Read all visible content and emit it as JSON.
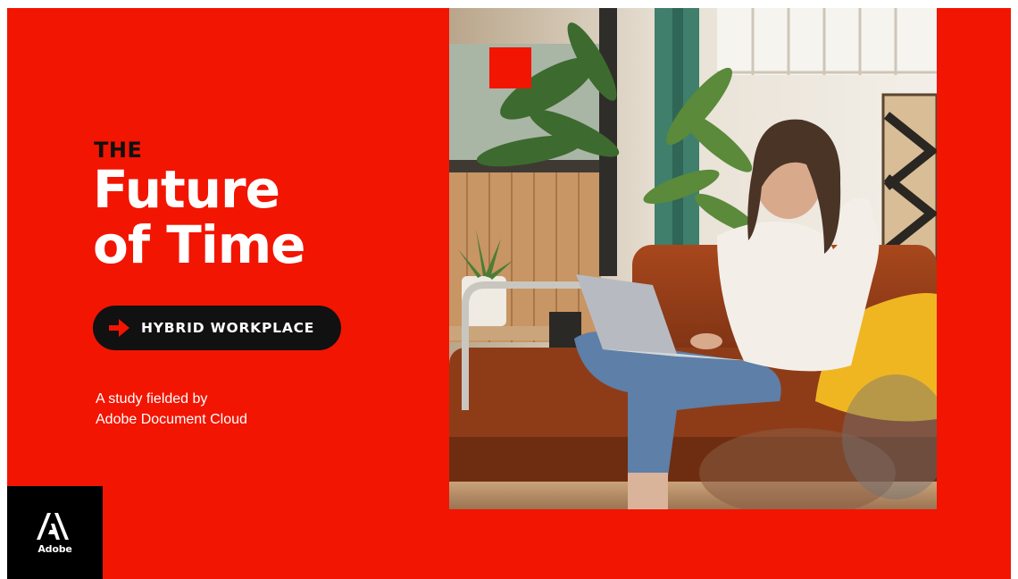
{
  "brand": {
    "accent_color": "#f21502",
    "dark_color": "#111111",
    "logo_text": "Adobe",
    "logo_icon": "adobe-logo-icon"
  },
  "hero": {
    "eyebrow": "THE",
    "title_line1": "Future",
    "title_line2": "of Time"
  },
  "tag": {
    "icon": "arrow-right-icon",
    "label": "HYBRID WORKPLACE"
  },
  "byline": {
    "line1": "A study fielded by",
    "line2": "Adobe Document Cloud"
  },
  "photo": {
    "subject": "woman-on-sofa-with-laptop"
  }
}
